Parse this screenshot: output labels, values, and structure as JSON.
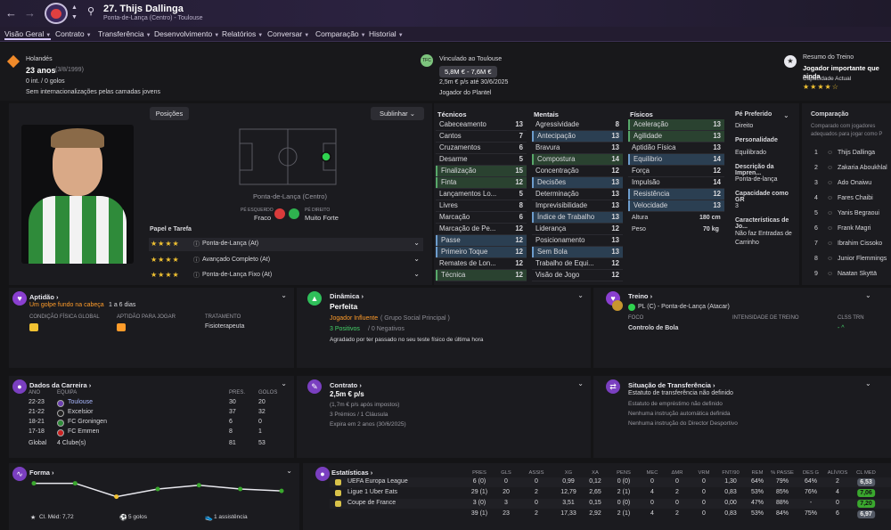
{
  "header": {
    "number_name": "27. Thijs Dallinga",
    "subtitle": "Ponta-de-Lança (Centro) - Toulouse"
  },
  "nav": [
    "Visão Geral",
    "Contrato",
    "Transferência",
    "Desenvolvimento",
    "Relatórios",
    "Conversar",
    "Comparação",
    "Historial"
  ],
  "info": {
    "nationality": "Holandés",
    "age": "23 anos",
    "dob": "(3/8/1999)",
    "caps": "0 int. / 0 golos",
    "youth": "Sem internacionalizações pelas camadas jovens"
  },
  "contract": {
    "label": "Vinculado ao Toulouse",
    "value": "5,8M € - 7,6M €",
    "wage": "2,5m € p/s até 30/6/2025",
    "status": "Jogador do Plantel"
  },
  "training": {
    "label": "Resumo do Treino",
    "text": "Jogador importante que ainda",
    "ability": "Capacidade Actual",
    "stars": "★★★★☆"
  },
  "positions": {
    "btn": "Posições",
    "highlight": "Sublinhar",
    "position": "Ponta-de-Lança (Centro)",
    "left_foot_lbl": "PÉ ESQUERDO",
    "left_foot": "Fraco",
    "right_foot_lbl": "PÉ DIREITO",
    "right_foot": "Muito Forte"
  },
  "roles": {
    "title": "Papel e Tarefa",
    "items": [
      {
        "stars": "★★★★",
        "name": "Ponta-de-Lança (At)"
      },
      {
        "stars": "★★★★",
        "name": "Avançado Completo (At)"
      },
      {
        "stars": "★★★★",
        "name": "Ponta-de-Lança Fixo (At)"
      }
    ]
  },
  "technical": {
    "title": "Técnicos",
    "rows": [
      [
        "Cabeceamento",
        "13"
      ],
      [
        "Cantos",
        "7"
      ],
      [
        "Cruzamentos",
        "6"
      ],
      [
        "Desarme",
        "5"
      ],
      [
        "Finalização",
        "15"
      ],
      [
        "Finta",
        "12"
      ],
      [
        "Lançamentos Lo...",
        "5"
      ],
      [
        "Livres",
        "8"
      ],
      [
        "Marcação",
        "6"
      ],
      [
        "Marcação de Pe...",
        "12"
      ],
      [
        "Passe",
        "12"
      ],
      [
        "Primeiro Toque",
        "12"
      ],
      [
        "Remates de Lon...",
        "12"
      ],
      [
        "Técnica",
        "12"
      ]
    ]
  },
  "mental": {
    "title": "Mentais",
    "rows": [
      [
        "Agressividade",
        "8"
      ],
      [
        "Antecipação",
        "13"
      ],
      [
        "Bravura",
        "13"
      ],
      [
        "Compostura",
        "14"
      ],
      [
        "Concentração",
        "12"
      ],
      [
        "Decisões",
        "13"
      ],
      [
        "Determinação",
        "13"
      ],
      [
        "Imprevisibilidade",
        "13"
      ],
      [
        "Índice de Trabalho",
        "13"
      ],
      [
        "Liderança",
        "12"
      ],
      [
        "Posicionamento",
        "13"
      ],
      [
        "Sem Bola",
        "13"
      ],
      [
        "Trabalho de Equi...",
        "12"
      ],
      [
        "Visão de Jogo",
        "12"
      ]
    ]
  },
  "physical": {
    "title": "Físicos",
    "rows": [
      [
        "Aceleração",
        "13"
      ],
      [
        "Agilidade",
        "13"
      ],
      [
        "Aptidão Física",
        "13"
      ],
      [
        "Equilibrio",
        "14"
      ],
      [
        "Força",
        "12"
      ],
      [
        "Impulsão",
        "14"
      ],
      [
        "Resistência",
        "12"
      ],
      [
        "Velocidade",
        "13"
      ]
    ],
    "height_lbl": "Altura",
    "height": "180 cm",
    "weight_lbl": "Peso",
    "weight": "70 kg"
  },
  "side": {
    "foot_lbl": "Pé Preferido",
    "foot": "Direito",
    "pers_lbl": "Personalidade",
    "pers": "Equilibrado",
    "desc_lbl": "Descrição da Impren...",
    "desc": "Ponta-de-lança",
    "cap_lbl": "Capacidade como GR",
    "cap": "3",
    "char_lbl": "Características de Jo...",
    "char": "Não faz Entradas de Carrinho"
  },
  "compare": {
    "title": "Comparação",
    "text": "Comparado com jogadores adequados para jogar como P",
    "list": [
      "Thijs Dallinga",
      "Zakaria Aboukhlal",
      "Ado Onaiwu",
      "Fares Chaibi",
      "Yanis Begraoui",
      "Frank Magri",
      "Ibrahim Cissoko",
      "Junior Flemmings",
      "Naatan Skyttä"
    ]
  },
  "aptidao": {
    "title": "Aptidão",
    "alert": "Um golpe fundo na cabeça",
    "alert2": "1 a 6 dias",
    "c1": "CONDIÇÃO FÍSICA GLOBAL",
    "c2": "APTIDÃO PARA JOGAR",
    "c3": "TRATAMENTO",
    "treat": "Fisioterapeuta"
  },
  "dinamica": {
    "title": "Dinâmica",
    "state": "Perfeita",
    "influ": "Jogador Influente",
    "group": "( Grupo Social Principal )",
    "pos": "3 Positivos",
    "neg": "/ 0 Negativos",
    "note": "Agradado por ter passado no seu teste físico de última hora"
  },
  "treino": {
    "title": "Treino",
    "role": "PL (C) - Ponta-de-Lança (Atacar)",
    "c1": "FOCO",
    "c2": "INTENSIDADE DE TREINO",
    "c3": "CLSS TRN",
    "focus": "Controlo de Bola",
    "clss": "- ^"
  },
  "career": {
    "title": "Dados da Carreira",
    "h": [
      "ANO",
      "EQUIPA",
      "PRES.",
      "GOLOS"
    ],
    "rows": [
      [
        "22-23",
        "Toulouse",
        "30",
        "20"
      ],
      [
        "21-22",
        "Excelsior",
        "37",
        "32"
      ],
      [
        "18-21",
        "FC Groningen",
        "6",
        "0"
      ],
      [
        "17-18",
        "FC Emmen",
        "8",
        "1"
      ]
    ],
    "total": [
      "Global",
      "4 Clube(s)",
      "81",
      "53"
    ]
  },
  "contrato2": {
    "title": "Contrato",
    "wage": "2,5m € p/s",
    "after": "(1,7m € p/s após impostos)",
    "bonus": "3 Prémios / 1 Cláusula",
    "exp": "Expira em 2 anos (30/6/2025)"
  },
  "transfer": {
    "title": "Situação de Transferência",
    "status": "Estatuto de transferência não definido",
    "l1": "Estatuto de empréstimo não definido",
    "l2": "Nenhuma instrução automática definida",
    "l3": "Nenhuma instrução do Director Desportivo"
  },
  "forma": {
    "title": "Forma",
    "avg": "Cl. Méd: 7,72",
    "goals": "5 golos",
    "assists": "1 assistência",
    "points": [
      7.9,
      7.9,
      7.55,
      7.75,
      7.85,
      7.75,
      7.7
    ]
  },
  "stats": {
    "title": "Estatísticas",
    "h": [
      "PRES",
      "GLS",
      "ASSIS",
      "XG",
      "XA",
      "PENS",
      "MEC",
      "ΔMR",
      "VRM",
      "FNT/90",
      "REM",
      "% PASSE",
      "DES G",
      "ALÍVIOS",
      "CL MED"
    ],
    "rows": [
      {
        "comp": "UEFA Europa League",
        "v": [
          "6 (0)",
          "0",
          "0",
          "0,99",
          "0,12",
          "0 (0)",
          "0",
          "0",
          "0",
          "1,30",
          "64%",
          "79%",
          "64%",
          "2",
          "6,53"
        ],
        "c": "#555b66"
      },
      {
        "comp": "Ligue 1 Uber Eats",
        "v": [
          "29 (1)",
          "20",
          "2",
          "12,79",
          "2,65",
          "2 (1)",
          "4",
          "2",
          "0",
          "0,83",
          "53%",
          "85%",
          "76%",
          "4",
          "7,06"
        ],
        "c": "#3aa82e"
      },
      {
        "comp": "Coupe de France",
        "v": [
          "3 (0)",
          "3",
          "0",
          "3,51",
          "0,15",
          "0 (0)",
          "0",
          "0",
          "0",
          "0,00",
          "47%",
          "88%",
          "-",
          "0",
          "7,20"
        ],
        "c": "#3aa82e"
      },
      {
        "comp": "",
        "v": [
          "39 (1)",
          "23",
          "2",
          "17,33",
          "2,92",
          "2 (1)",
          "4",
          "2",
          "0",
          "0,83",
          "53%",
          "84%",
          "75%",
          "6",
          "6,97"
        ],
        "c": "#555b66"
      }
    ]
  }
}
